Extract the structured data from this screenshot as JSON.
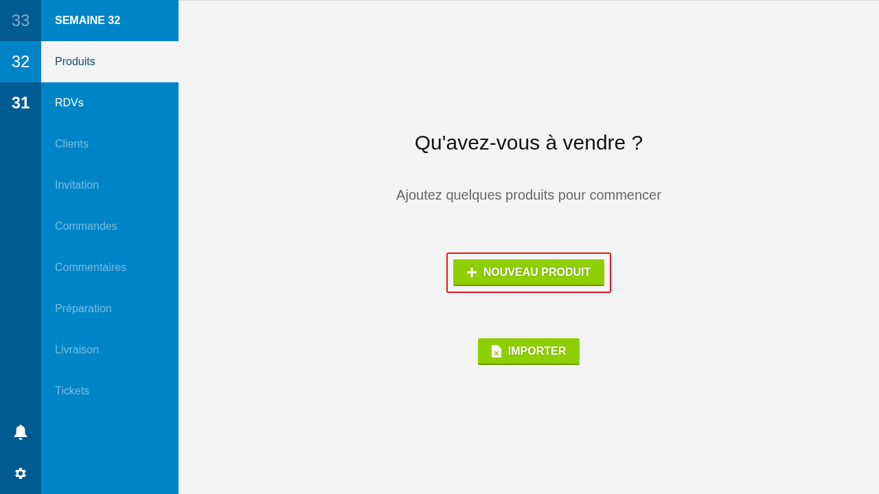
{
  "weeks": [
    {
      "label": "33",
      "selected": false,
      "current": false,
      "disabled": true
    },
    {
      "label": "32",
      "selected": true,
      "current": false,
      "disabled": false
    },
    {
      "label": "31",
      "selected": false,
      "current": true,
      "disabled": false
    }
  ],
  "menu": {
    "title": "SEMAINE 32",
    "items": [
      {
        "label": "Produits",
        "selected": true,
        "disabled": false
      },
      {
        "label": "RDVs",
        "selected": false,
        "disabled": false
      },
      {
        "label": "Clients",
        "selected": false,
        "disabled": true
      },
      {
        "label": "Invitation",
        "selected": false,
        "disabled": true
      },
      {
        "label": "Commandes",
        "selected": false,
        "disabled": true
      },
      {
        "label": "Commentaires",
        "selected": false,
        "disabled": true
      },
      {
        "label": "Préparation",
        "selected": false,
        "disabled": true
      },
      {
        "label": "Livraison",
        "selected": false,
        "disabled": true
      },
      {
        "label": "Tickets",
        "selected": false,
        "disabled": true
      }
    ]
  },
  "main": {
    "heading": "Qu'avez-vous à vendre ?",
    "subtitle": "Ajoutez quelques produits pour commencer",
    "buttons": [
      {
        "kind": "add",
        "label": "NOUVEAU PRODUIT",
        "highlighted": true
      },
      {
        "kind": "import",
        "label": "IMPORTER",
        "highlighted": false
      }
    ]
  }
}
